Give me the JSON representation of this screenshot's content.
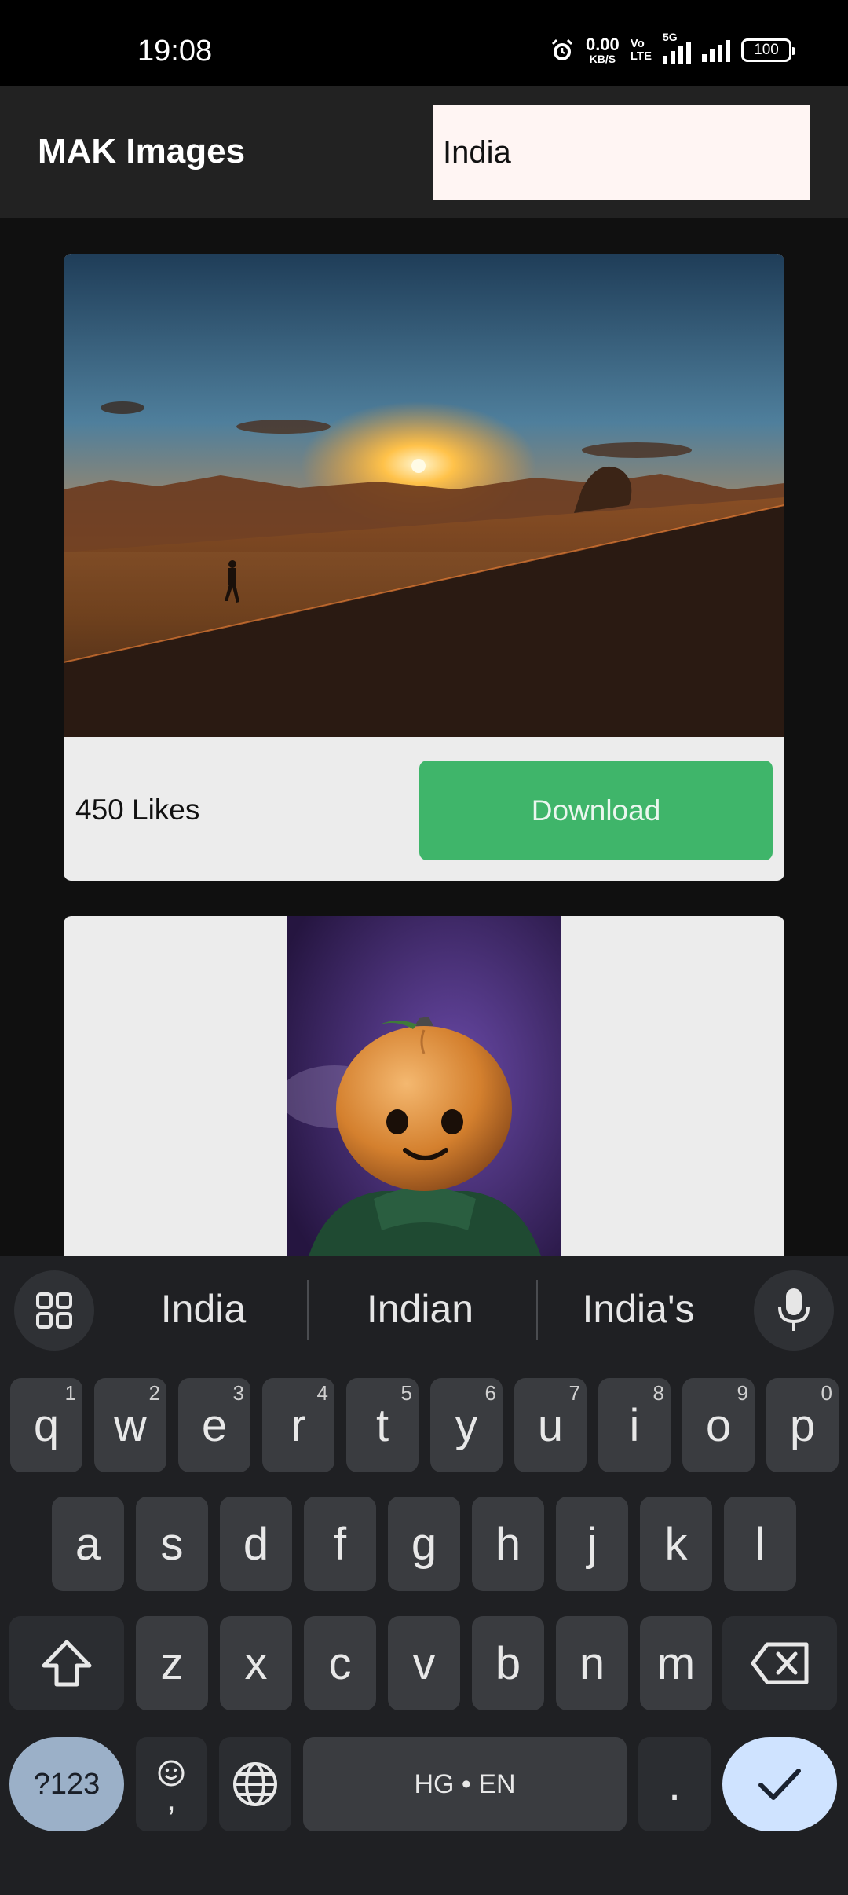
{
  "status_bar": {
    "time": "19:08",
    "net_speed_value": "0.00",
    "net_speed_unit": "KB/S",
    "volte_top": "Vo",
    "volte_bottom": "LTE",
    "network_5g": "5G",
    "battery": "100"
  },
  "app_bar": {
    "title": "MAK Images",
    "search_value": "India"
  },
  "cards": [
    {
      "likes": "450 Likes",
      "download_label": "Download"
    }
  ],
  "keyboard": {
    "suggestions": [
      "India",
      "Indian",
      "India's"
    ],
    "row1": [
      {
        "key": "q",
        "hint": "1"
      },
      {
        "key": "w",
        "hint": "2"
      },
      {
        "key": "e",
        "hint": "3"
      },
      {
        "key": "r",
        "hint": "4"
      },
      {
        "key": "t",
        "hint": "5"
      },
      {
        "key": "y",
        "hint": "6"
      },
      {
        "key": "u",
        "hint": "7"
      },
      {
        "key": "i",
        "hint": "8"
      },
      {
        "key": "o",
        "hint": "9"
      },
      {
        "key": "p",
        "hint": "0"
      }
    ],
    "row2": [
      "a",
      "s",
      "d",
      "f",
      "g",
      "h",
      "j",
      "k",
      "l"
    ],
    "row3": [
      "z",
      "x",
      "c",
      "v",
      "b",
      "n",
      "m"
    ],
    "symbols_label": "?123",
    "comma_label": ",",
    "space_label": "HG • EN",
    "period_label": "."
  },
  "colors": {
    "download_green": "#3fb56a",
    "app_bar": "#222222",
    "search_bg": "#fff5f3"
  }
}
